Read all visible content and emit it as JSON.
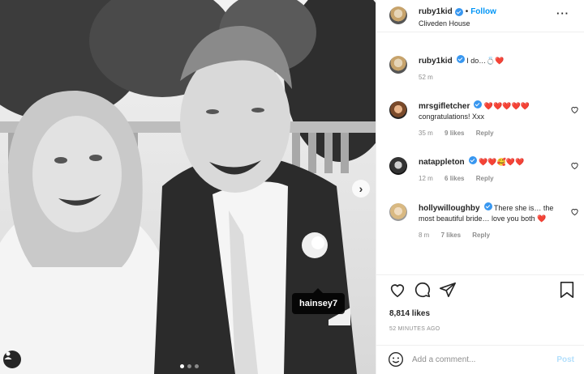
{
  "header": {
    "username": "ruby1kid",
    "follow_label": "Follow",
    "location": "Cliveden House",
    "more_icon": "more-horizontal-icon"
  },
  "photo": {
    "tag_username": "hainsey7",
    "carousel_dots": 3,
    "active_dot": 0
  },
  "caption": {
    "username": "ruby1kid",
    "text": "I do…💍❤️",
    "time": "52 m"
  },
  "comments": [
    {
      "username": "mrsgifletcher",
      "verified": true,
      "text": "❤️❤️❤️❤️❤️ congratulations! Xxx",
      "time": "35 m",
      "likes": "9 likes",
      "reply": "Reply"
    },
    {
      "username": "natappleton",
      "verified": true,
      "text": "❤️❤️🥰❤️❤️",
      "time": "12 m",
      "likes": "6 likes",
      "reply": "Reply"
    },
    {
      "username": "hollywilloughby",
      "verified": true,
      "text": "There she is… the most beautiful bride… love you both ❤️",
      "time": "8 m",
      "likes": "7 likes",
      "reply": "Reply"
    }
  ],
  "likes_count": "8,814 likes",
  "posted_ago": "52 MINUTES AGO",
  "add_comment": {
    "placeholder": "Add a comment...",
    "post_label": "Post"
  },
  "colors": {
    "link_blue": "#0095f6",
    "verified_blue": "#3897f0",
    "heart_red": "#ed1c24",
    "muted_gray": "#8e8e8e"
  }
}
